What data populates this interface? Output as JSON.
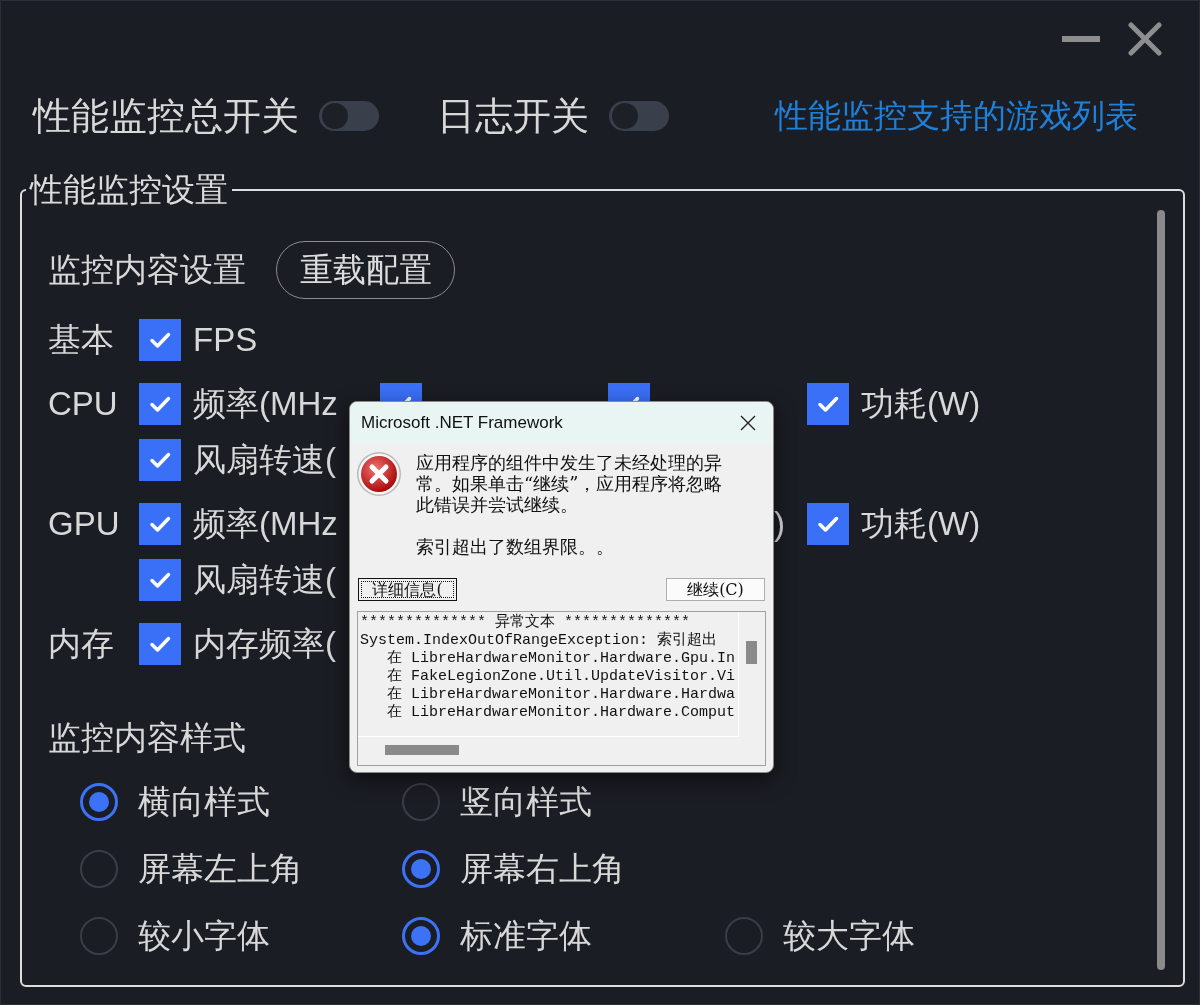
{
  "header": {
    "switches": [
      {
        "label": "性能监控总开关",
        "on": false
      },
      {
        "label": "日志开关",
        "on": false
      }
    ],
    "link": "性能监控支持的游戏列表"
  },
  "settings": {
    "title": "性能监控设置",
    "content_heading": "监控内容设置",
    "reload_button": "重载配置",
    "groups": [
      {
        "label": "基本",
        "items": [
          {
            "kind": "checkbox",
            "label": "FPS",
            "checked": true
          }
        ]
      },
      {
        "label": "CPU",
        "items": [
          {
            "kind": "checkbox",
            "label": "频率(MHz",
            "checked": true
          },
          {
            "kind": "checkbox",
            "checked": true
          },
          {
            "kind": "checkbox",
            "checked": true
          },
          {
            "kind": "checkbox",
            "label": "功耗(W)",
            "checked": true
          },
          {
            "kind": "checkbox",
            "label": "风扇转速(",
            "checked": true
          }
        ]
      },
      {
        "label": "GPU",
        "items": [
          {
            "kind": "checkbox",
            "label": "频率(MHz",
            "checked": true
          },
          {
            "kind": "tail",
            "label": ")"
          },
          {
            "kind": "checkbox",
            "label": "功耗(W)",
            "checked": true
          },
          {
            "kind": "checkbox",
            "label": "风扇转速(",
            "checked": true
          }
        ]
      },
      {
        "label": "内存",
        "items": [
          {
            "kind": "checkbox",
            "label": "内存频率(",
            "checked": true
          }
        ]
      }
    ],
    "style_heading": "监控内容样式",
    "style_rows": [
      {
        "options": [
          {
            "label": "横向样式",
            "selected": true
          },
          {
            "label": "竖向样式",
            "selected": false
          }
        ]
      },
      {
        "options": [
          {
            "label": "屏幕左上角",
            "selected": false
          },
          {
            "label": "屏幕右上角",
            "selected": true
          }
        ]
      },
      {
        "options": [
          {
            "label": "较小字体",
            "selected": false
          },
          {
            "label": "标准字体",
            "selected": true
          },
          {
            "label": "较大字体",
            "selected": false
          }
        ]
      }
    ]
  },
  "dialog": {
    "title": "Microsoft .NET Framework",
    "message": "应用程序的组件中发生了未经处理的异常。如果单击“继续”，应用程序将忽略此错误并尝试继续。",
    "detail": "索引超出了数组界限。。",
    "buttons": [
      {
        "label": "详细信息(",
        "focused": true
      },
      {
        "label": "继续(C)",
        "focused": false
      }
    ],
    "details_lines": [
      "************** 异常文本 **************",
      "System.IndexOutOfRangeException: 索引超出",
      "   在 LibreHardwareMonitor.Hardware.Gpu.In",
      "   在 FakeLegionZone.Util.UpdateVisitor.Vi",
      "   在 LibreHardwareMonitor.Hardware.Hardwa",
      "   在 LibreHardwareMonitor.Hardware.Comput"
    ]
  }
}
